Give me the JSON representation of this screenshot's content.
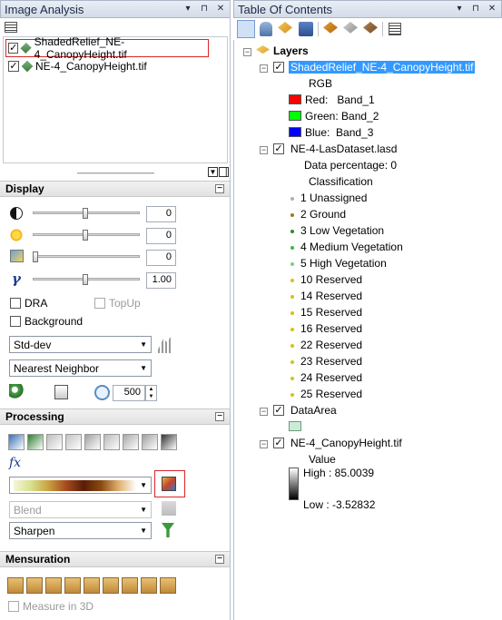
{
  "image_analysis": {
    "title": "Image Analysis",
    "pin": "▾ ⊞",
    "close": "✕",
    "layers": [
      {
        "name": "ShadedRelief_NE-4_CanopyHeight.tif",
        "checked": true,
        "highlighted": true
      },
      {
        "name": "NE-4_CanopyHeight.tif",
        "checked": true,
        "highlighted": false
      }
    ]
  },
  "display": {
    "title": "Display",
    "sliders": [
      {
        "icon": "contrast-icon",
        "value": "0",
        "level": 0.5
      },
      {
        "icon": "brightness-icon",
        "value": "0",
        "level": 0.5
      },
      {
        "icon": "transparency-icon",
        "value": "0",
        "level": 0.0
      },
      {
        "icon": "gamma-icon",
        "value": "1.00",
        "level": 0.5
      }
    ],
    "gamma_symbol": "γ",
    "dra_label": "DRA",
    "topup_label": "TopUp",
    "background_label": "Background",
    "stretch_value": "Std-dev",
    "resample_value": "Nearest Neighbor",
    "zoom_value": "500"
  },
  "processing": {
    "title": "Processing",
    "blend_value": "Blend",
    "sharpen_value": "Sharpen",
    "fx_label": "fx"
  },
  "mensuration": {
    "title": "Mensuration",
    "measure3d_label": "Measure in 3D"
  },
  "toc": {
    "title": "Table Of Contents",
    "pin": "▾ ⊞",
    "close": "✕",
    "layers_label": "Layers",
    "shaded": {
      "name": "ShadedRelief_NE-4_CanopyHeight.tif",
      "rgb_label": "RGB",
      "bands": [
        {
          "label": "Red:   Band_1",
          "color": "#ff0000"
        },
        {
          "label": "Green: Band_2",
          "color": "#00ff00"
        },
        {
          "label": "Blue:  Band_3",
          "color": "#0000ff"
        }
      ]
    },
    "las": {
      "name": "NE-4-LasDataset.lasd",
      "data_pct": "Data percentage: 0",
      "classification": "Classification",
      "classes": [
        {
          "label": "1  Unassigned",
          "color": "#b0b0b0"
        },
        {
          "label": "2  Ground",
          "color": "#9a7a2a"
        },
        {
          "label": "3  Low Vegetation",
          "color": "#2e8b2e"
        },
        {
          "label": "4  Medium Vegetation",
          "color": "#3cb83c"
        },
        {
          "label": "5  High Vegetation",
          "color": "#7ad27a"
        },
        {
          "label": "10  Reserved",
          "color": "#d4c21a"
        },
        {
          "label": "14  Reserved",
          "color": "#d4c21a"
        },
        {
          "label": "15  Reserved",
          "color": "#d4c21a"
        },
        {
          "label": "16  Reserved",
          "color": "#d4c21a"
        },
        {
          "label": "22  Reserved",
          "color": "#d4c21a"
        },
        {
          "label": "23  Reserved",
          "color": "#d4c21a"
        },
        {
          "label": "24  Reserved",
          "color": "#d4c21a"
        },
        {
          "label": "25  Reserved",
          "color": "#d4c21a"
        }
      ]
    },
    "data_area": {
      "name": "DataArea",
      "color": "#ccebd6"
    },
    "canopy": {
      "name": "NE-4_CanopyHeight.tif",
      "value_label": "Value",
      "high": "High : 85.0039",
      "low": "Low : -3.52832"
    }
  }
}
